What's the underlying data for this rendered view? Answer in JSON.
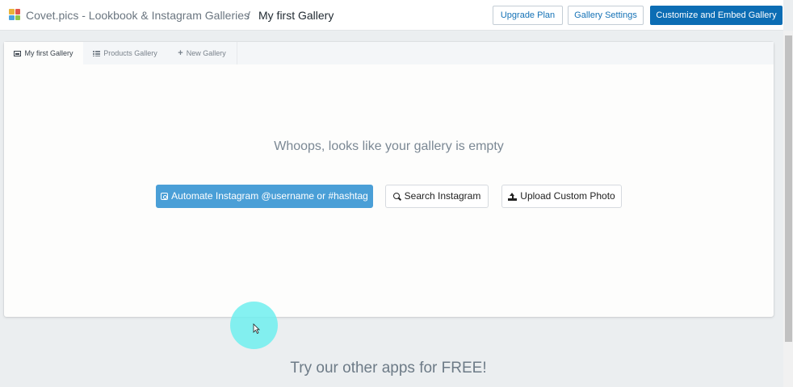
{
  "header": {
    "app_title": "Covet.pics - Lookbook & Instagram Galleries",
    "separator": "/",
    "current_page": "My first Gallery",
    "buttons": {
      "upgrade": "Upgrade Plan",
      "settings": "Gallery Settings",
      "customize": "Customize and Embed Gallery"
    },
    "logo_colors": [
      "#e8b33a",
      "#e2574c",
      "#4aa3df",
      "#8fc54a"
    ]
  },
  "tabs": [
    {
      "label": "My first Gallery",
      "icon": "image-icon",
      "active": true
    },
    {
      "label": "Products Gallery",
      "icon": "grid-icon",
      "active": false
    },
    {
      "label": "New Gallery",
      "icon": "plus-icon",
      "active": false
    }
  ],
  "main": {
    "empty_message": "Whoops, looks like your gallery is empty",
    "actions": {
      "automate": "Automate Instagram @username or #hashtag",
      "search": "Search Instagram",
      "upload": "Upload Custom Photo"
    }
  },
  "footer": {
    "promo_title": "Try our other apps for FREE!"
  },
  "colors": {
    "primary": "#0c6db4",
    "action_blue": "#4a9fd7",
    "cursor_highlight": "#70eeee"
  }
}
